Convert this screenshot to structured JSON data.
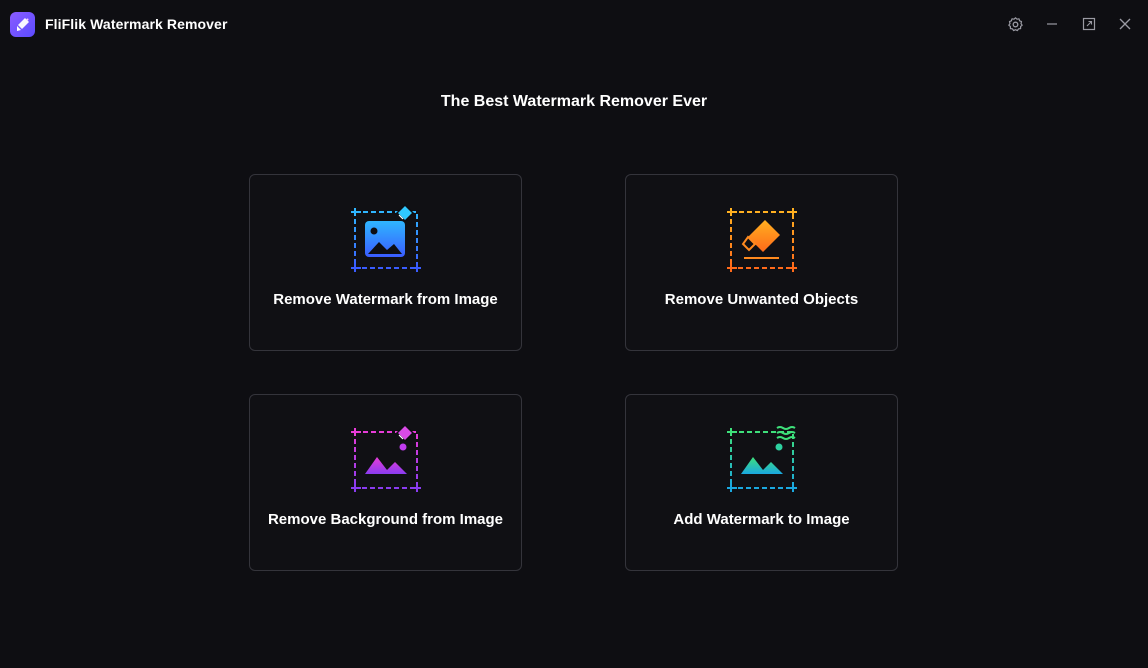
{
  "app": {
    "title": "FliFlik Watermark Remover"
  },
  "window_controls": {
    "settings": "gear-icon",
    "minimize": "minimize-icon",
    "maximize": "maximize-icon",
    "close": "close-icon"
  },
  "main": {
    "heading": "The Best Watermark Remover Ever",
    "cards": [
      {
        "label": "Remove Watermark from Image",
        "icon": "image-watermark-icon",
        "color": "#2f8cff"
      },
      {
        "label": "Remove Unwanted Objects",
        "icon": "eraser-icon",
        "color": "#ff8a1f"
      },
      {
        "label": "Remove Background from Image",
        "icon": "background-remove-icon",
        "color": "#c13cf0"
      },
      {
        "label": "Add Watermark to Image",
        "icon": "add-watermark-icon",
        "color": "#1ec7b5"
      }
    ]
  }
}
